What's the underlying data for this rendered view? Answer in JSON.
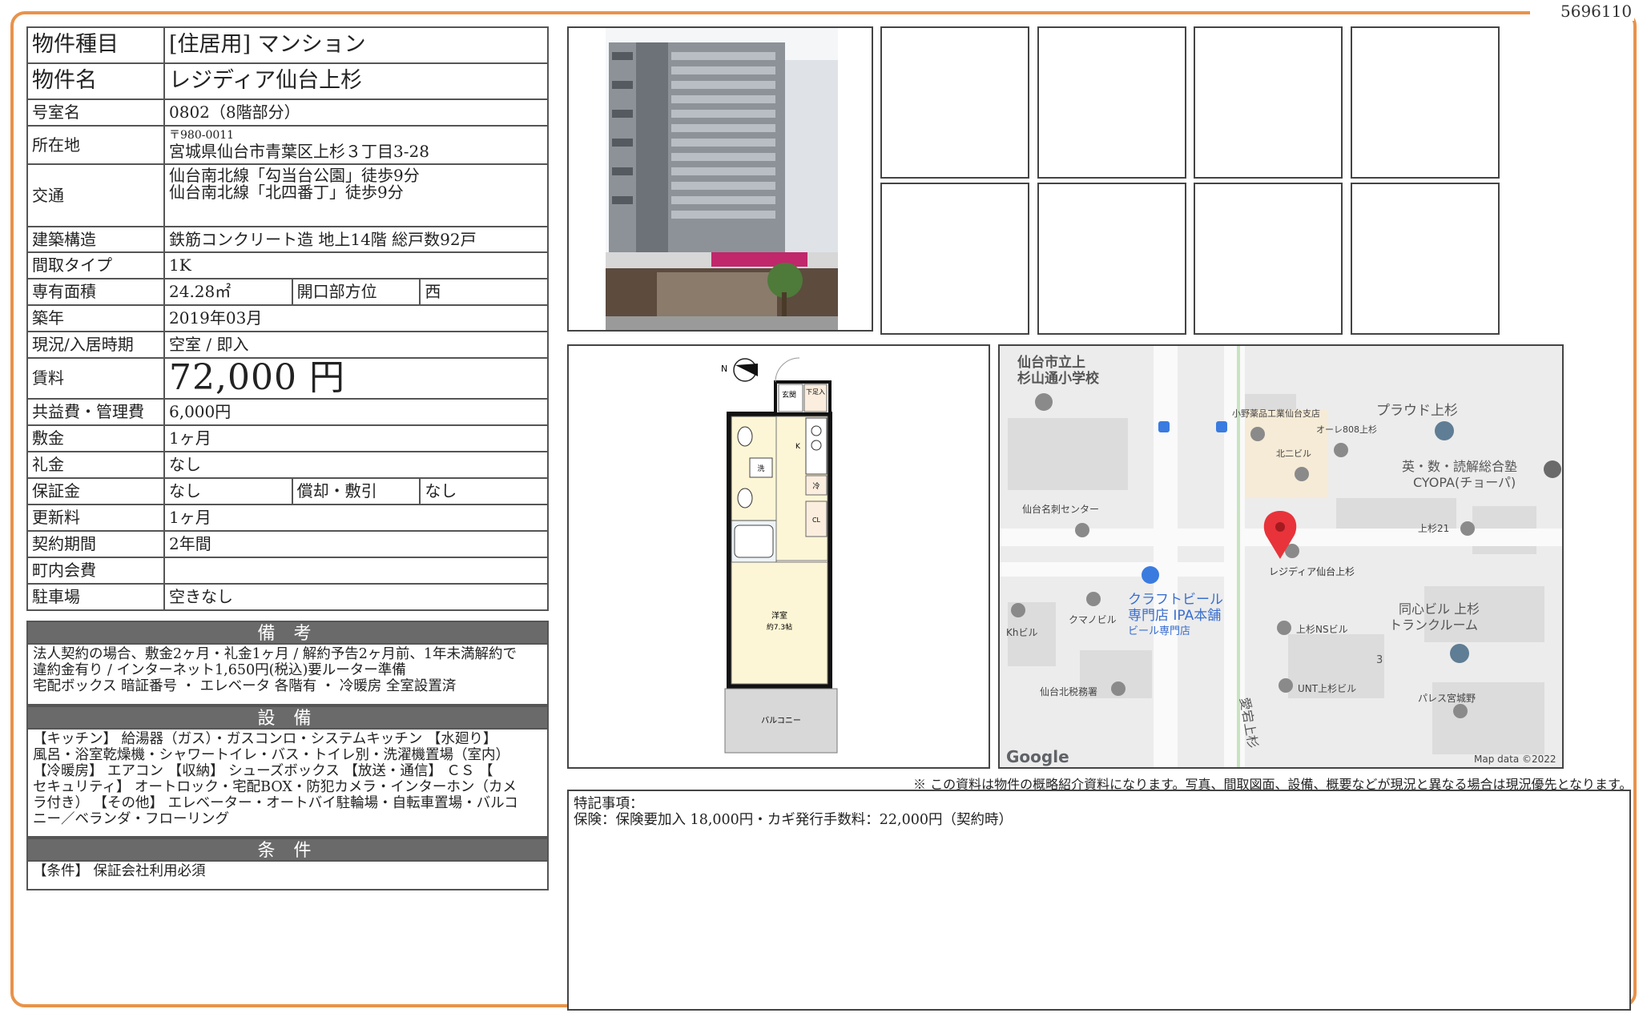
{
  "doc_id": "5696110",
  "property": {
    "type_label": "物件種目",
    "type_value": "[住居用] マンション",
    "name_label": "物件名",
    "name_value": "レジディア仙台上杉",
    "room_label": "号室名",
    "room_value": "0802（8階部分）",
    "address_label": "所在地",
    "address_zip": "〒980-0011",
    "address_value": "宮城県仙台市青葉区上杉３丁目3-28",
    "access_label": "交通",
    "access_line1": "仙台南北線「勾当台公園」徒歩9分",
    "access_line2": "仙台南北線「北四番丁」徒歩9分",
    "structure_label": "建築構造",
    "structure_value": "鉄筋コンクリート造 地上14階 総戸数92戸",
    "layout_label": "間取タイプ",
    "layout_value": "1K",
    "area_label": "専有面積",
    "area_value": "24.28㎡",
    "direction_label": "開口部方位",
    "direction_value": "西",
    "built_label": "築年",
    "built_value": "2019年03月",
    "status_label": "現況/入居時期",
    "status_value": "空室 / 即入",
    "rent_label": "賃料",
    "rent_value": "72,000 円",
    "fee_label": "共益費・管理費",
    "fee_value": "6,000円",
    "deposit_label": "敷金",
    "deposit_value": "1ヶ月",
    "key_money_label": "礼金",
    "key_money_value": "なし",
    "guarantee_label": "保証金",
    "guarantee_value": "なし",
    "amort_label": "償却・敷引",
    "amort_value": "なし",
    "renewal_label": "更新料",
    "renewal_value": "1ヶ月",
    "contract_label": "契約期間",
    "contract_value": "2年間",
    "community_label": "町内会費",
    "community_value": "",
    "parking_label": "駐車場",
    "parking_value": "空きなし"
  },
  "notes": {
    "title": "備 考",
    "lines": [
      "法人契約の場合、敷金2ヶ月・礼金1ヶ月 / 解約予告2ヶ月前、1年未満解約で",
      "違約金有り / インターネット1,650円(税込)要ルーター準備",
      "宅配ボックス 暗証番号 ・ エレベータ 各階有 ・ 冷暖房 全室設置済"
    ]
  },
  "equipment": {
    "title": "設 備",
    "lines": [
      "【キッチン】 給湯器（ガス）・ガスコンロ・システムキッチン 【水廻り】",
      "風呂・浴室乾燥機・シャワートイレ・バス・トイレ別・洗濯機置場（室内）",
      "【冷暖房】 エアコン 【収納】 シューズボックス 【放送・通信】 ＣＳ 【",
      "セキュリティ】 オートロック・宅配BOX・防犯カメラ・インターホン（カメ",
      "ラ付き） 【その他】 エレベーター・オートバイ駐輪場・自転車置場・バルコ",
      "ニー／ベランダ・フローリング"
    ]
  },
  "conditions": {
    "title": "条 件",
    "lines": [
      "【条件】 保証会社利用必須"
    ]
  },
  "floorplan": {
    "entrance": "玄関",
    "shoes": "下足入",
    "kitchen": "K",
    "wash": "洗",
    "fridge": "冷",
    "closet": "CL",
    "room": "洋室",
    "room_size": "約7.3帖",
    "balcony": "バルコニー",
    "north": "N"
  },
  "map": {
    "labels": {
      "school1": "仙台市立上",
      "school2": "杉山通小学校",
      "onoyakuhin": "小野薬品工業仙台支店",
      "proud": "プラウド上杉",
      "ore808": "オーレ808上杉",
      "kitani": "北二ビル",
      "cram1": "英・数・読解総合塾",
      "cram2": "CYOPA(チョーパ)",
      "sendai_meishi": "仙台名刺センター",
      "kamisugi21": "上杉21",
      "target": "レジディア仙台上杉",
      "craft1": "クラフトビール",
      "craft2": "専門店 IPA本舗",
      "craft3": "ビール専門店",
      "kumano": "クマノビル",
      "kh": "Khビル",
      "ns": "上杉NSビル",
      "doshin1": "同心ビル 上杉",
      "doshin2": "トランクルーム",
      "three": "3",
      "unt": "UNT上杉ビル",
      "tax": "仙台北税務署",
      "palace": "パレス宮城野",
      "street": "愛宕上杉",
      "google": "Google",
      "mapdata": "Map data ©2022"
    }
  },
  "notice": "※ この資料は物件の概略紹介資料になります。写真、間取図面、設備、概要などが現況と異なる場合は現況優先となります。",
  "remarks": {
    "title": "特記事項：",
    "line1": "保険：保険要加入 18,000円・カギ発行手数料：22,000円（契約時）"
  },
  "colors": {
    "frame": "#e8934a",
    "section_header": "#6a6a6a",
    "map_pin": "#e8333a",
    "map_bg": "#ececec"
  }
}
